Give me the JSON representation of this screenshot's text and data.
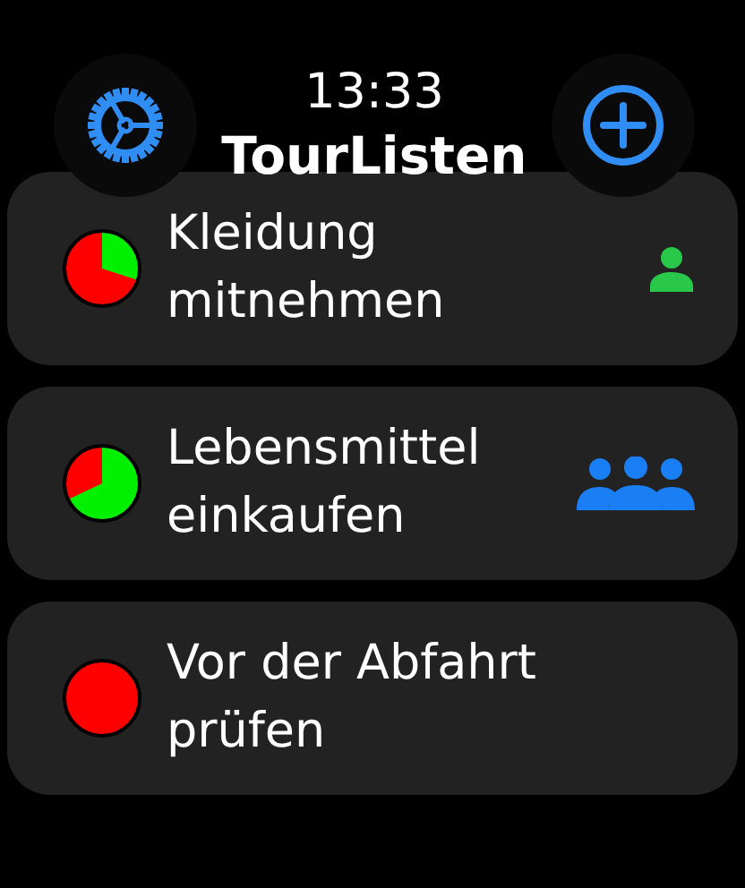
{
  "header": {
    "time": "13:33",
    "title": "TourListen"
  },
  "lists": [
    {
      "name": "Kleidung mitnehmen",
      "kind": "single"
    },
    {
      "name": "Lebensmittel einkaufen",
      "kind": "group"
    },
    {
      "name": "Vor der Abfahrt prüfen",
      "kind": "private"
    }
  ]
}
